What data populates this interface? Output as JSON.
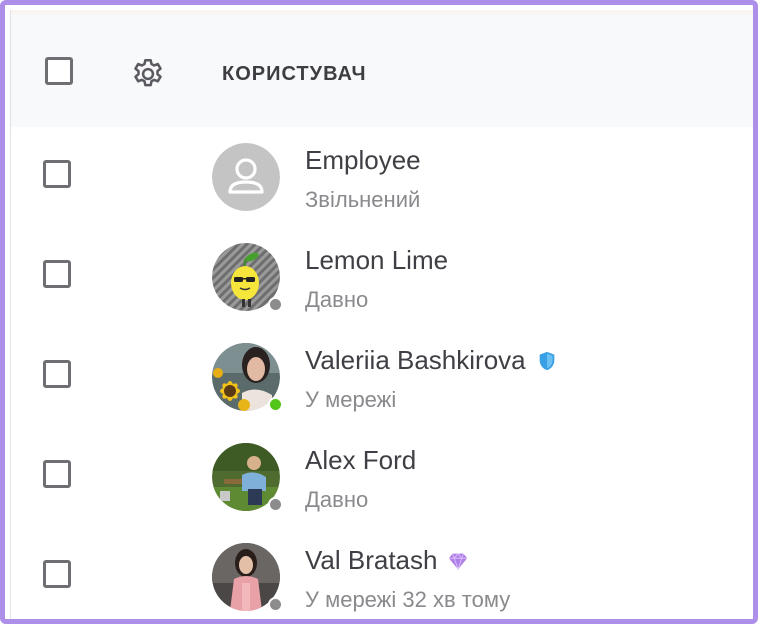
{
  "header": {
    "column_title": "КОРИСТУВАЧ",
    "select_all_icon": "checkbox-unchecked",
    "settings_icon": "gear-icon"
  },
  "colors": {
    "frame_border": "#ab8fe8",
    "online": "#52c41a",
    "offline": "#8c8c8c",
    "shield_badge": "#3aa0e6",
    "diamond_badge": "#b07ee8"
  },
  "users": [
    {
      "name": "Employee",
      "status": "Звільнений",
      "avatar": "default-user-icon",
      "presence": "none",
      "badge": "none"
    },
    {
      "name": "Lemon Lime",
      "status": "Давно",
      "avatar": "lemon-avatar",
      "presence": "offline",
      "badge": "none"
    },
    {
      "name": "Valeriia Bashkirova",
      "status": "У мережі",
      "avatar": "sunflower-photo-avatar",
      "presence": "online",
      "badge": "shield-icon"
    },
    {
      "name": "Alex Ford",
      "status": "Давно",
      "avatar": "park-photo-avatar",
      "presence": "offline",
      "badge": "none"
    },
    {
      "name": "Val Bratash",
      "status": "У мережі 32 хв тому",
      "avatar": "portrait-photo-avatar",
      "presence": "offline",
      "badge": "diamond-icon"
    }
  ]
}
